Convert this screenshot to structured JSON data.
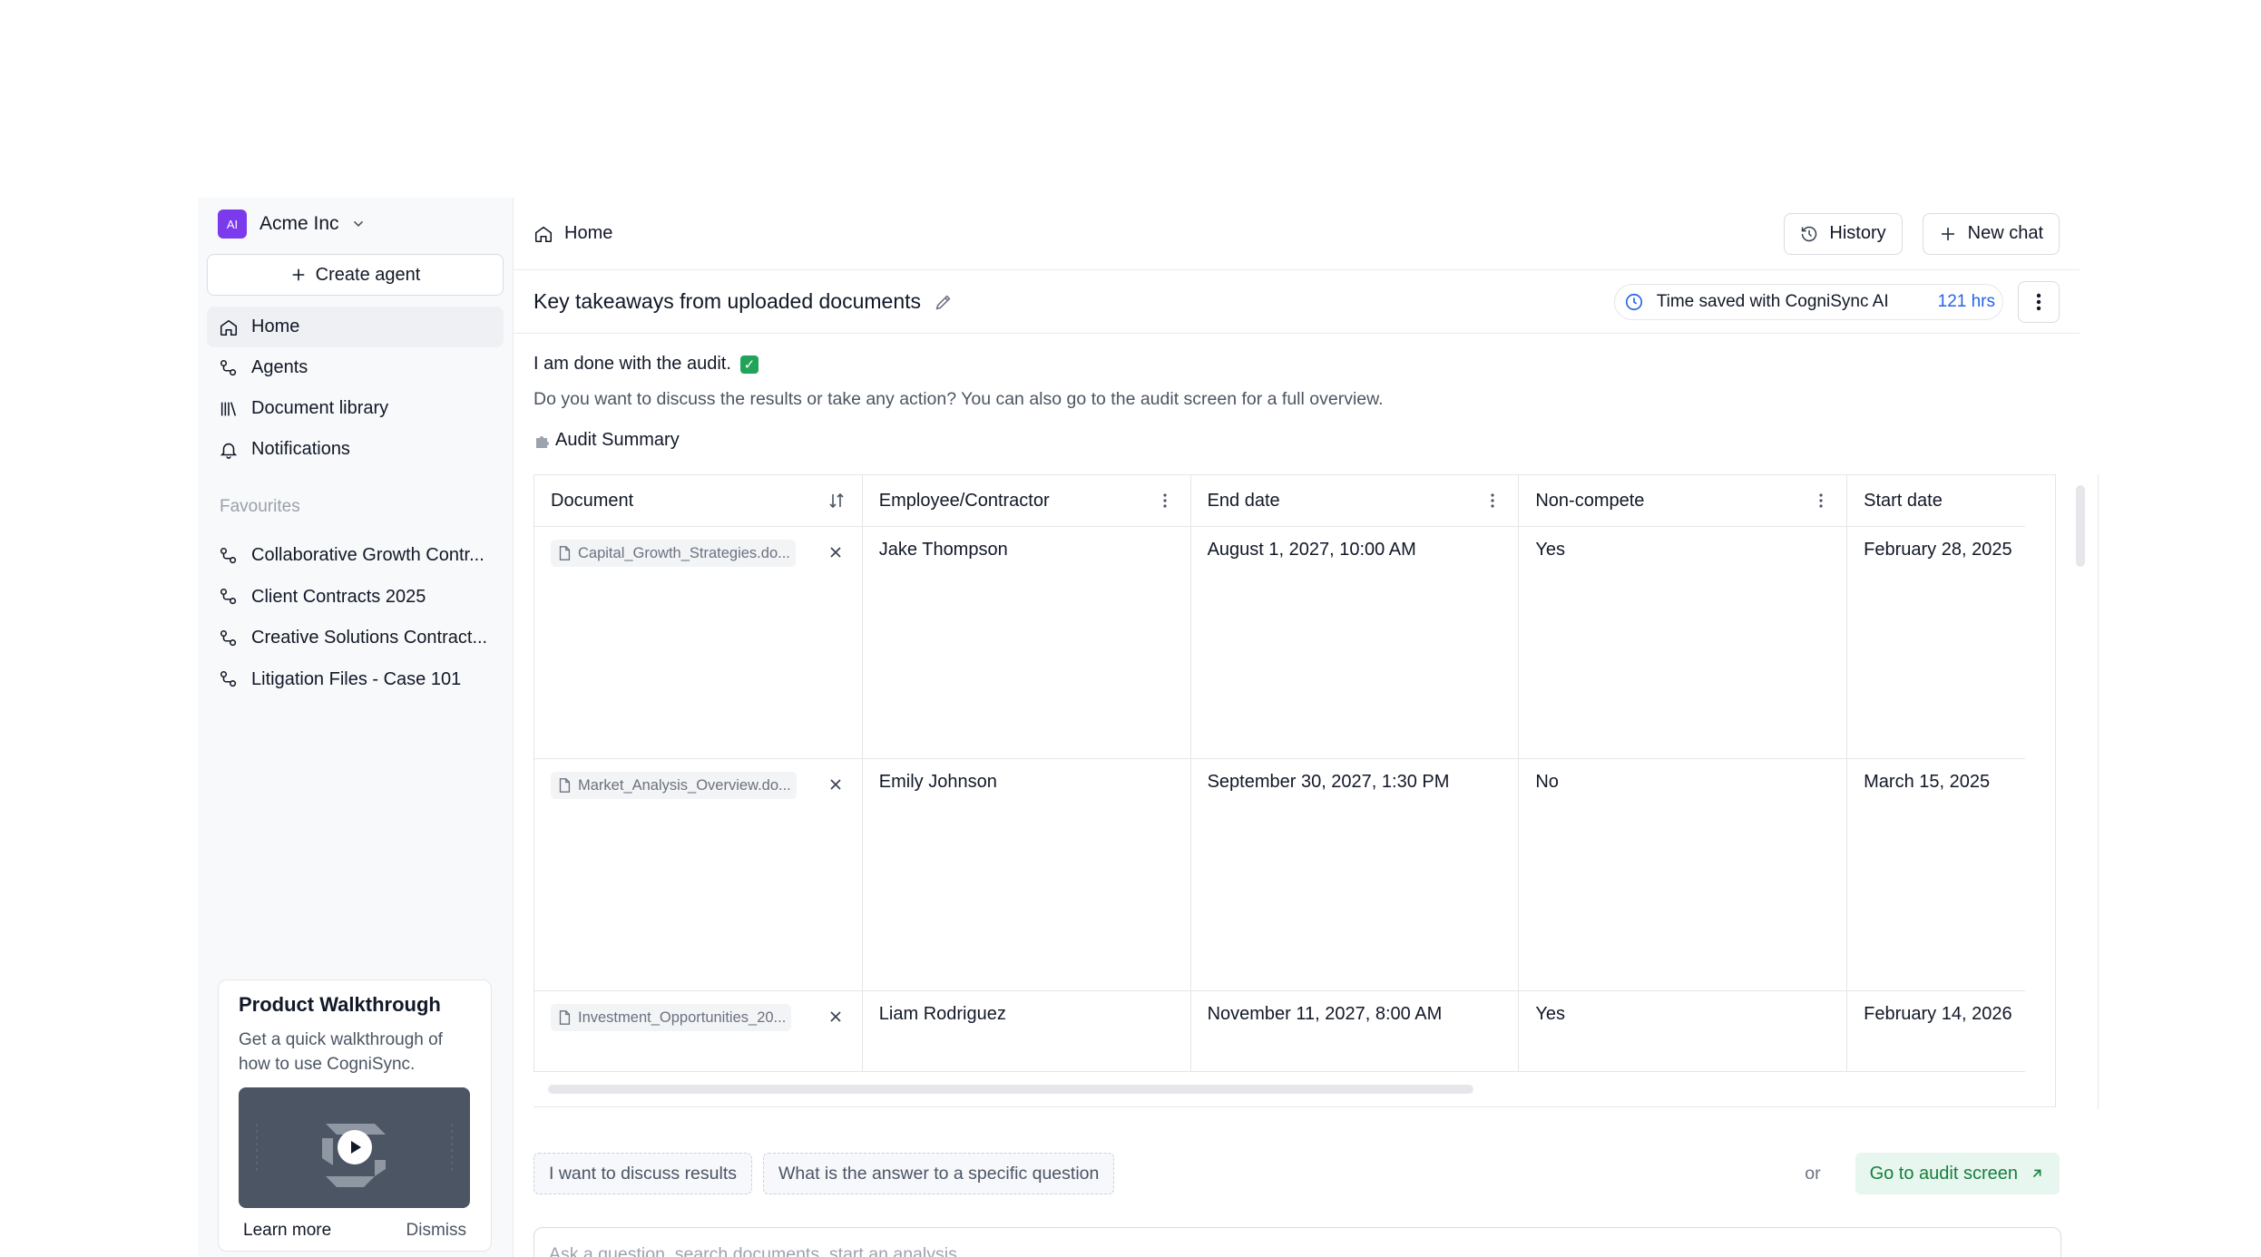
{
  "org": {
    "logo_text": "AI",
    "name": "Acme Inc"
  },
  "sidebar": {
    "create_label": "Create agent",
    "nav": [
      {
        "label": "Home",
        "icon": "home-icon"
      },
      {
        "label": "Agents",
        "icon": "agents-icon"
      },
      {
        "label": "Document library",
        "icon": "library-icon"
      },
      {
        "label": "Notifications",
        "icon": "bell-icon"
      }
    ],
    "favourites_title": "Favourites",
    "favourites": [
      "Collaborative Growth Contr...",
      "Client Contracts 2025",
      "Creative Solutions Contract...",
      "Litigation Files - Case 101"
    ]
  },
  "walkthrough": {
    "title": "Product Walkthrough",
    "description": "Get a quick walkthrough of how to use CogniSync.",
    "learn_more": "Learn more",
    "dismiss": "Dismiss"
  },
  "header": {
    "breadcrumb": "Home",
    "history_label": "History",
    "new_chat_label": "New chat"
  },
  "titlebar": {
    "title": "Key takeaways from uploaded documents",
    "saved_label": "Time saved with CogniSync AI",
    "saved_value": "121 hrs"
  },
  "message": {
    "done": "I am done with the audit.",
    "question": "Do you want to discuss the results or take any action? You can also go to the audit screen for a full overview.",
    "summary_title": "Audit Summary"
  },
  "table": {
    "columns": [
      "Document",
      "Employee/Contractor",
      "End date",
      "Non-compete",
      "Start date"
    ],
    "rows": [
      {
        "document": "Capital_Growth_Strategies.do...",
        "employee": "Jake Thompson",
        "end": "August 1, 2027, 10:00 AM",
        "noncompete": "Yes",
        "start": "February 28, 2025"
      },
      {
        "document": "Market_Analysis_Overview.do...",
        "employee": "Emily Johnson",
        "end": "September 30, 2027, 1:30 PM",
        "noncompete": "No",
        "start": "March 15, 2025"
      },
      {
        "document": "Investment_Opportunities_20...",
        "employee": "Liam Rodriguez",
        "end": "November 11, 2027, 8:00 AM",
        "noncompete": "Yes",
        "start": "February 14, 2026"
      }
    ]
  },
  "suggestions": [
    "I want to discuss results",
    "What is the answer to a specific question"
  ],
  "or_label": "or",
  "go_audit_label": "Go to audit screen",
  "ask": {
    "placeholder": "Ask a question, search documents, start an analysis..."
  },
  "colors": {
    "accent": "#7c3aed",
    "link": "#2563eb",
    "success": "#15803d"
  }
}
